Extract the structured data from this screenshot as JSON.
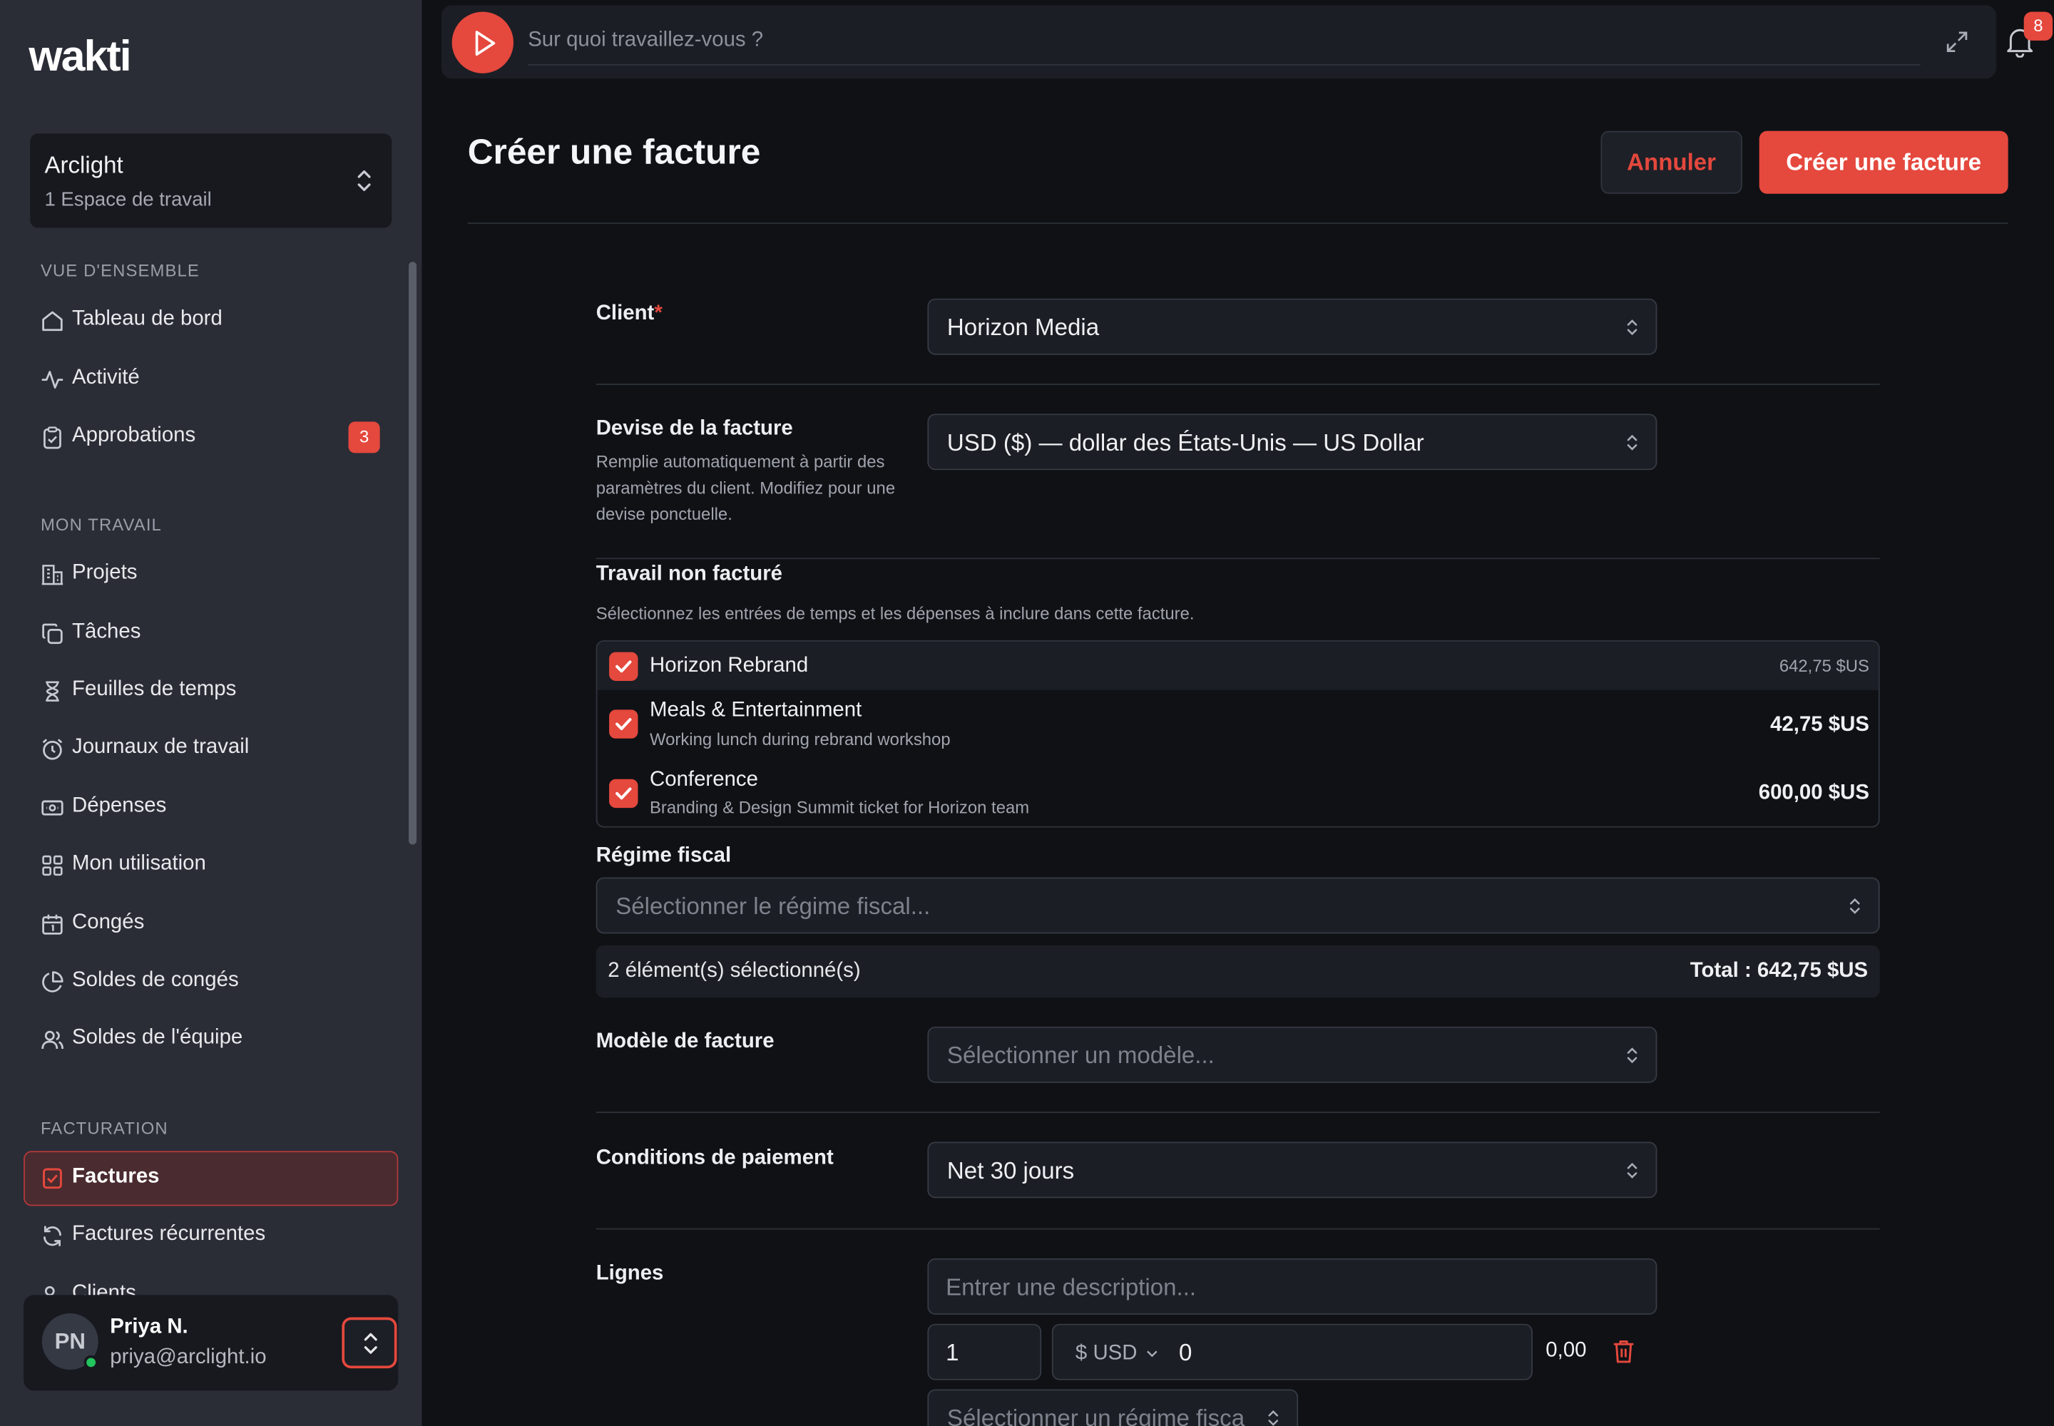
{
  "app": {
    "logo": "wakti"
  },
  "workspace": {
    "name": "Arclight",
    "subtitle": "1 Espace de travail"
  },
  "sidebar": {
    "sections": {
      "overview": "VUE D'ENSEMBLE",
      "my_work": "MON TRAVAIL",
      "billing": "FACTURATION"
    },
    "items": [
      {
        "label": "Tableau de bord",
        "icon": "home-icon"
      },
      {
        "label": "Activité",
        "icon": "activity-icon"
      },
      {
        "label": "Approbations",
        "icon": "clipboard-check-icon",
        "badge": "3"
      },
      {
        "label": "Projets",
        "icon": "building-icon"
      },
      {
        "label": "Tâches",
        "icon": "copy-icon"
      },
      {
        "label": "Feuilles de temps",
        "icon": "hourglass-icon"
      },
      {
        "label": "Journaux de travail",
        "icon": "alarm-clock-icon"
      },
      {
        "label": "Dépenses",
        "icon": "banknote-icon"
      },
      {
        "label": "Mon utilisation",
        "icon": "grid-icon"
      },
      {
        "label": "Congés",
        "icon": "calendar-icon"
      },
      {
        "label": "Soldes de congés",
        "icon": "pie-chart-icon"
      },
      {
        "label": "Soldes de l'équipe",
        "icon": "users-icon"
      },
      {
        "label": "Factures",
        "icon": "invoice-check-icon",
        "active": true
      },
      {
        "label": "Factures récurrentes",
        "icon": "refresh-icon"
      },
      {
        "label": "Clients",
        "icon": "users-icon"
      }
    ]
  },
  "user": {
    "initials": "PN",
    "name": "Priya N.",
    "email": "priya@arclight.io",
    "status": "online"
  },
  "topbar": {
    "timer_placeholder": "Sur quoi travaillez-vous ?",
    "notification_count": "8"
  },
  "page": {
    "title": "Créer une facture",
    "cancel_label": "Annuler",
    "create_label": "Créer une facture"
  },
  "form": {
    "client": {
      "label": "Client",
      "required_mark": "*",
      "value": "Horizon Media"
    },
    "currency": {
      "label": "Devise de la facture",
      "help": "Remplie automatiquement à partir des paramètres du client. Modifiez pour une devise ponctuelle.",
      "value": "USD ($) — dollar des États-Unis — US Dollar"
    },
    "unbilled": {
      "title": "Travail non facturé",
      "subtitle": "Sélectionnez les entrées de temps et les dépenses à inclure dans cette facture.",
      "group": {
        "title": "Horizon Rebrand",
        "amount": "642,75 $US",
        "checked": true
      },
      "items": [
        {
          "title": "Meals & Entertainment",
          "subtitle": "Working lunch during rebrand workshop",
          "amount": "42,75 $US",
          "checked": true
        },
        {
          "title": "Conference",
          "subtitle": "Branding & Design Summit ticket for Horizon team",
          "amount": "600,00 $US",
          "checked": true
        }
      ]
    },
    "tax_regime": {
      "label": "Régime fiscal",
      "placeholder": "Sélectionner le régime fiscal..."
    },
    "summary": {
      "selected": "2 élément(s) sélectionné(s)",
      "total": "Total : 642,75 $US"
    },
    "template": {
      "label": "Modèle de facture",
      "placeholder": "Sélectionner un modèle..."
    },
    "payment_terms": {
      "label": "Conditions de paiement",
      "value": "Net 30 jours"
    },
    "lines": {
      "label": "Lignes",
      "description_placeholder": "Entrer une description...",
      "quantity": "1",
      "currency": "$ USD",
      "price": "0",
      "line_total": "0,00",
      "tax_placeholder": "Sélectionner un régime fisca"
    }
  },
  "colors": {
    "accent": "#e5483d",
    "sidebar_bg": "#2a2d36",
    "page_bg": "#0f1115",
    "field_bg": "#1b1e24"
  }
}
